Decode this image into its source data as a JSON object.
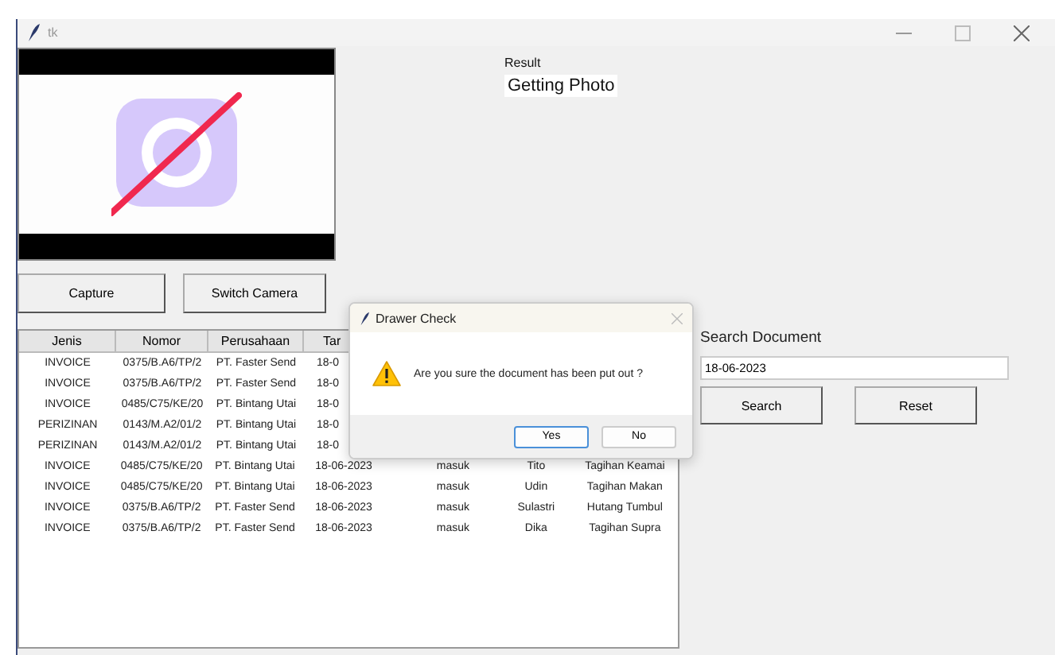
{
  "window": {
    "title": "tk"
  },
  "result": {
    "label": "Result",
    "value": "Getting Photo"
  },
  "camera_buttons": [
    "Capture",
    "Switch Camera"
  ],
  "table": {
    "columns": [
      "Jenis",
      "Nomor",
      "Perusahaan",
      "Tar"
    ],
    "rows": [
      [
        "INVOICE",
        "0375/B.A6/TP/2",
        "PT. Faster Send",
        "18-0"
      ],
      [
        "INVOICE",
        "0375/B.A6/TP/2",
        "PT. Faster Send",
        "18-0"
      ],
      [
        "INVOICE",
        "0485/C75/KE/20",
        "PT. Bintang Utai",
        "18-0"
      ],
      [
        "PERIZINAN",
        "0143/M.A2/01/2",
        "PT. Bintang Utai",
        "18-0"
      ],
      [
        "PERIZINAN",
        "0143/M.A2/01/2",
        "PT. Bintang Utai",
        "18-0"
      ],
      [
        "INVOICE",
        "0485/C75/KE/20",
        "PT. Bintang Utai",
        "18-06-2023",
        "masuk",
        "Tito",
        "Tagihan Keamai"
      ],
      [
        "INVOICE",
        "0485/C75/KE/20",
        "PT. Bintang Utai",
        "18-06-2023",
        "masuk",
        "Udin",
        "Tagihan Makan"
      ],
      [
        "INVOICE",
        "0375/B.A6/TP/2",
        "PT. Faster Send",
        "18-06-2023",
        "masuk",
        "Sulastri",
        "Hutang Tumbul"
      ],
      [
        "INVOICE",
        "0375/B.A6/TP/2",
        "PT. Faster Send",
        "18-06-2023",
        "masuk",
        "Dika",
        "Tagihan Supra"
      ]
    ]
  },
  "search": {
    "label": "Search Document",
    "value": "18-06-2023",
    "buttons": [
      "Search",
      "Reset"
    ]
  },
  "dialog": {
    "title": "Drawer Check",
    "message": "Are you sure the document has been put out ?",
    "buttons": [
      {
        "label": "Yes",
        "selected": true
      },
      {
        "label": "No",
        "selected": false
      }
    ]
  }
}
